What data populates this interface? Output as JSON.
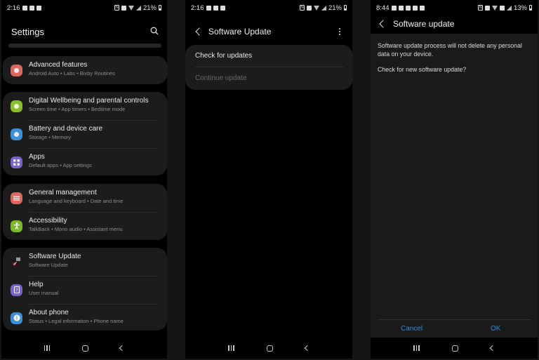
{
  "panels": {
    "settings": {
      "status": {
        "time": "2:16",
        "battery": "21%"
      },
      "title": "Settings",
      "search_icon": "search-icon",
      "groups": [
        {
          "items": [
            {
              "title": "Advanced features",
              "subtitle": "Android Auto  •  Labs  •  Bixby Routines",
              "icon": "gear-plus-icon",
              "color": "#d9695c"
            }
          ]
        },
        {
          "items": [
            {
              "title": "Digital Wellbeing and parental controls",
              "subtitle": "Screen time  •  App timers  •  Bedtime mode",
              "icon": "wellbeing-icon",
              "color": "#8bbf2a"
            },
            {
              "title": "Battery and device care",
              "subtitle": "Storage  •  Memory",
              "icon": "device-care-icon",
              "color": "#3f8fd6"
            },
            {
              "title": "Apps",
              "subtitle": "Default apps  •  App settings",
              "icon": "apps-grid-icon",
              "color": "#7a63c9"
            }
          ]
        },
        {
          "items": [
            {
              "title": "General management",
              "subtitle": "Language and keyboard  •  Date and time",
              "icon": "sliders-icon",
              "color": "#d9695c"
            },
            {
              "title": "Accessibility",
              "subtitle": "TalkBack  •  Mono audio  •  Assistant menu",
              "icon": "accessibility-icon",
              "color": "#7cb92a"
            }
          ]
        },
        {
          "items": [
            {
              "title": "Software Update",
              "subtitle": "Software Update",
              "icon": "software-update-icon",
              "color": "transparent"
            },
            {
              "title": "Help",
              "subtitle": "User manual",
              "icon": "help-icon",
              "color": "#7a63c9"
            },
            {
              "title": "About phone",
              "subtitle": "Status  •  Legal information  •  Phone name",
              "icon": "info-icon",
              "color": "#3f8fd6"
            }
          ]
        }
      ]
    },
    "software_update": {
      "status": {
        "time": "2:16",
        "battery": "21%"
      },
      "title": "Software Update",
      "items": [
        {
          "label": "Check for updates",
          "enabled": true
        },
        {
          "label": "Continue update",
          "enabled": false
        }
      ]
    },
    "dialog": {
      "status": {
        "time": "8:44",
        "battery": "13%"
      },
      "title": "Software update",
      "message_1": "Software update process will not delete any personal data on your device.",
      "message_2": "Check for new software update?",
      "cancel_label": "Cancel",
      "ok_label": "OK",
      "accent": "#2d8ed8"
    }
  }
}
